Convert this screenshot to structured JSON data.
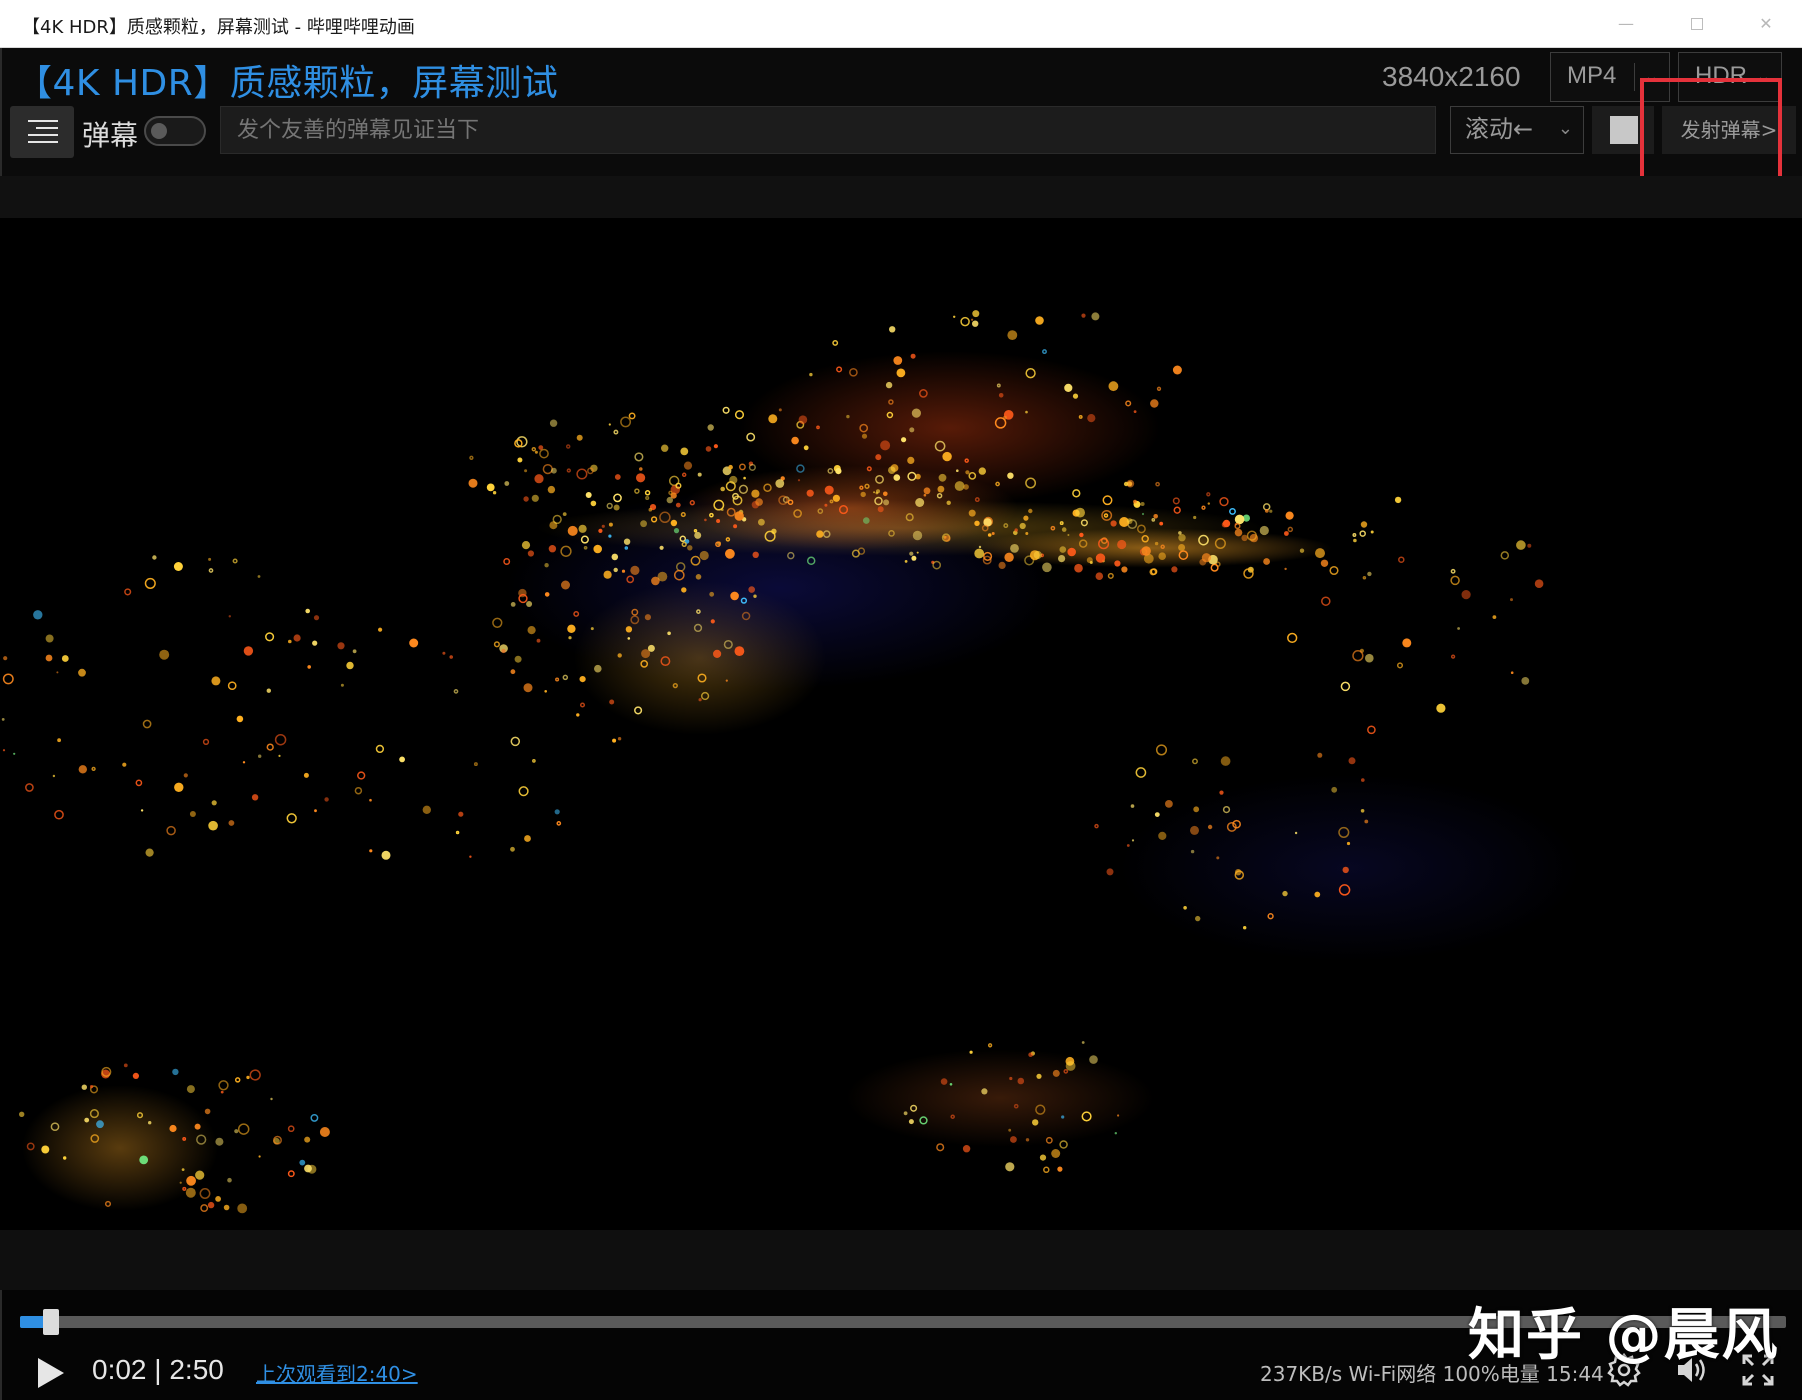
{
  "window": {
    "title": "【4K HDR】质感颗粒，屏幕测试 - 哔哩哔哩动画",
    "minimize_glyph": "—",
    "close_glyph": "✕"
  },
  "header": {
    "video_title": "【4K HDR】质感颗粒，屏幕测试",
    "resolution": "3840x2160",
    "format_select": "MP4",
    "dynamic_range_select": "HDR",
    "danmu_label": "弹幕",
    "danmu_toggle_on": false,
    "danmu_placeholder": "发个友善的弹幕见证当下",
    "danmu_mode_select": "滚动←",
    "danmu_color": "#c8c8c8",
    "send_button": "发射弹幕>"
  },
  "player": {
    "progress_fraction": 0.0118,
    "current_time": "0:02",
    "separator": " | ",
    "duration": "2:50",
    "resume_link": "上次观看到2:40>",
    "status_text": "237KB/s Wi-Fi网络 100%电量 15:44"
  },
  "icons": {
    "menu": "hamburger-icon",
    "play": "play-icon",
    "settings": "gear-icon",
    "volume": "volume-icon",
    "fullscreen": "fullscreen-icon"
  },
  "colors": {
    "accent": "#2f8fe3",
    "highlight": "#e5323b"
  },
  "watermark": "知乎 @晨风"
}
